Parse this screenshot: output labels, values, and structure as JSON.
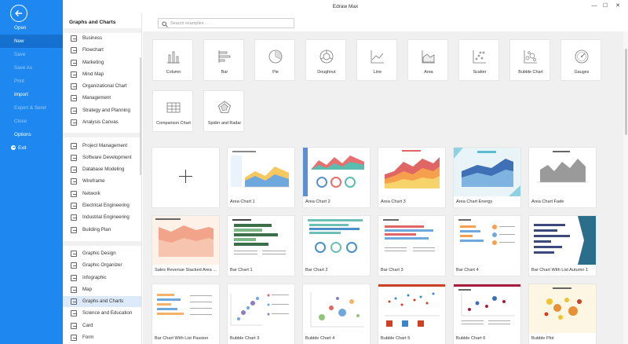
{
  "app": {
    "title": "Edraw Max"
  },
  "window": {
    "minimize": "—",
    "maximize": "☐",
    "close": "✕"
  },
  "menu": {
    "items": [
      {
        "id": "open",
        "label": "Open"
      },
      {
        "id": "new",
        "label": "New"
      },
      {
        "id": "save",
        "label": "Save"
      },
      {
        "id": "save-as",
        "label": "Save As"
      },
      {
        "id": "print",
        "label": "Print"
      },
      {
        "id": "import",
        "label": "Import"
      },
      {
        "id": "export-send",
        "label": "Export & Send"
      },
      {
        "id": "close",
        "label": "Close"
      },
      {
        "id": "options",
        "label": "Options"
      },
      {
        "id": "exit",
        "label": "Exit"
      }
    ]
  },
  "categories": {
    "header": "Graphs and Charts",
    "items": [
      "Business",
      "Flowchart",
      "Marketing",
      "Mind Map",
      "Organizational Chart",
      "Management",
      "Strategy and Planning",
      "Analysis Canvas",
      "Project Management",
      "Software Development",
      "Database Modeling",
      "Wireframe",
      "Network",
      "Electrical Engineering",
      "Industrial Engineering",
      "Building Plan",
      "Graphic Design",
      "Graphic Organizer",
      "Infographic",
      "Map",
      "Graphs and Charts",
      "Science and Education",
      "Card",
      "Form"
    ]
  },
  "search": {
    "placeholder": "Search examples . . . ."
  },
  "chart_types": [
    "Column",
    "Bar",
    "Pie",
    "Doughnut",
    "Line",
    "Area",
    "Scatter",
    "Bubble Chart",
    "Gauges",
    "Comparison Chart",
    "Spider and Radar"
  ],
  "templates": [
    "Area Chart 1",
    "Area Chart 2",
    "Area Chart 3",
    "Area Chart Energy",
    "Area Chart Fade",
    "Sales Revenue Stacked Area ...",
    "Bar Chart 1",
    "Bar Chart 2",
    "Bar Chart 3",
    "Bar Chart 4",
    "Bar Chart With List Autumn 1",
    "Bar Chart With List Passion",
    "Bubble Chart 3",
    "Bubble Chart 4",
    "Bubble Chart 5",
    "Bubble Chart 6",
    "Bubble Plot"
  ],
  "colors": {
    "menu_bg": "#1e88f0",
    "menu_active": "#1670cf",
    "selected_category": "#dbe9f8"
  }
}
